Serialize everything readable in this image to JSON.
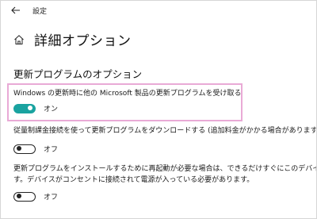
{
  "window": {
    "title": "設定",
    "back_icon": "back-arrow-icon"
  },
  "header": {
    "home_icon": "home-icon",
    "title": "詳細オプション"
  },
  "section": {
    "title": "更新プログラムのオプション"
  },
  "options": [
    {
      "description": "Windows の更新時に他の Microsoft 製品の更新プログラムを受け取る",
      "state_label": "オン",
      "on": true,
      "highlighted": true
    },
    {
      "description": "従量制課金接続を使って更新プログラムをダウンロードする (追加料金がかかる場合があります)",
      "state_label": "オフ",
      "on": false
    },
    {
      "description_line1": "更新プログラムをインストールするために再起動が必要な場合は、できるだけすぐにこのデバイスを再起",
      "description_line2": "す。デバイスがコンセントに接続されて電源が入っている必要があります。",
      "state_label": "オフ",
      "on": false
    }
  ],
  "colors": {
    "toggle_on": "#1aa3a0",
    "highlight_border": "#e9aad6"
  }
}
